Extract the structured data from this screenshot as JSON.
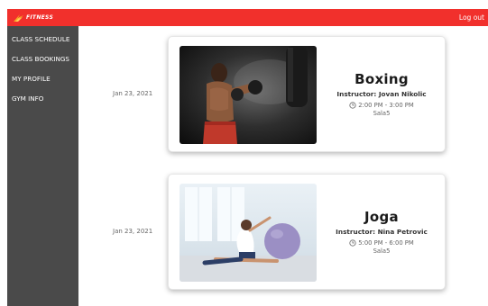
{
  "header": {
    "brand": "FITNESS",
    "logout_label": "Log out"
  },
  "sidebar": {
    "items": [
      {
        "label": "CLASS SCHEDULE"
      },
      {
        "label": "CLASS BOOKINGS"
      },
      {
        "label": "MY PROFILE"
      },
      {
        "label": "GYM INFO"
      }
    ]
  },
  "bookings": [
    {
      "date": "Jan 23, 2021",
      "title": "Boxing",
      "instructor": "Instructor: Jovan Nikolic",
      "time": "2:00 PM - 3:00 PM",
      "room": "Sala5",
      "image": "boxer-photo"
    },
    {
      "date": "Jan 23, 2021",
      "title": "Joga",
      "instructor": "Instructor: Nina Petrovic",
      "time": "5:00 PM - 6:00 PM",
      "room": "Sala5",
      "image": "yoga-photo"
    }
  ],
  "colors": {
    "header_bg": "#f1302c",
    "sidebar_bg": "#4a4a4a",
    "brand_accent": "#f5a623"
  },
  "icons": {
    "brand": "flame-logo-icon",
    "time": "clock-icon"
  }
}
